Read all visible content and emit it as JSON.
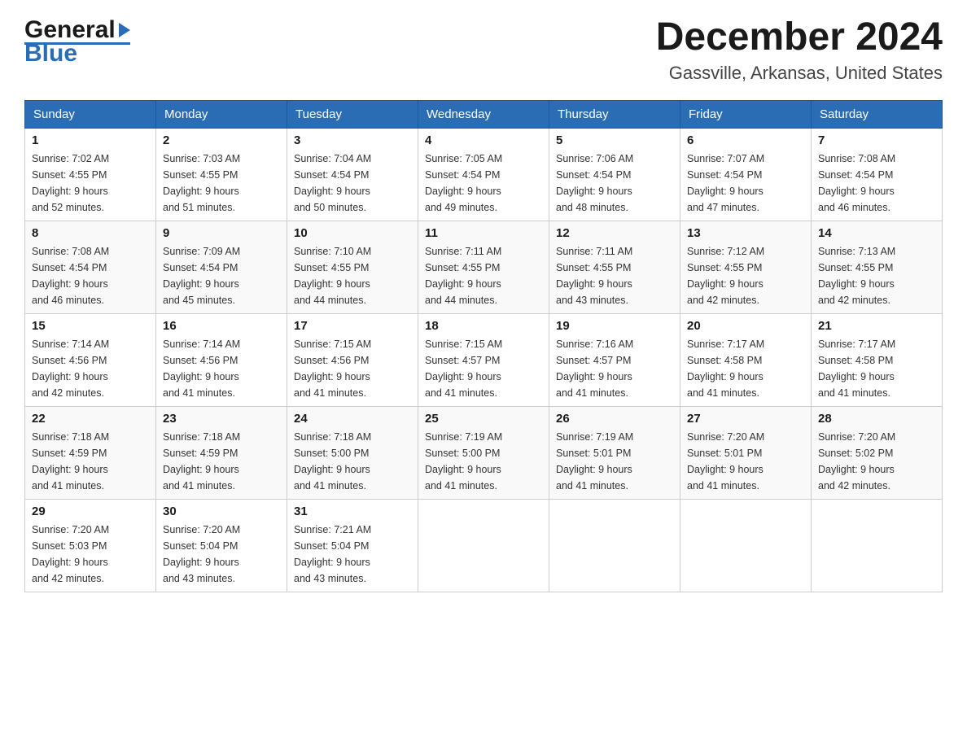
{
  "header": {
    "logo_text1": "General",
    "logo_text2": "Blue",
    "month_title": "December 2024",
    "location": "Gassville, Arkansas, United States"
  },
  "days_of_week": [
    "Sunday",
    "Monday",
    "Tuesday",
    "Wednesday",
    "Thursday",
    "Friday",
    "Saturday"
  ],
  "weeks": [
    [
      {
        "day": "1",
        "sunrise": "7:02 AM",
        "sunset": "4:55 PM",
        "daylight": "9 hours and 52 minutes."
      },
      {
        "day": "2",
        "sunrise": "7:03 AM",
        "sunset": "4:55 PM",
        "daylight": "9 hours and 51 minutes."
      },
      {
        "day": "3",
        "sunrise": "7:04 AM",
        "sunset": "4:54 PM",
        "daylight": "9 hours and 50 minutes."
      },
      {
        "day": "4",
        "sunrise": "7:05 AM",
        "sunset": "4:54 PM",
        "daylight": "9 hours and 49 minutes."
      },
      {
        "day": "5",
        "sunrise": "7:06 AM",
        "sunset": "4:54 PM",
        "daylight": "9 hours and 48 minutes."
      },
      {
        "day": "6",
        "sunrise": "7:07 AM",
        "sunset": "4:54 PM",
        "daylight": "9 hours and 47 minutes."
      },
      {
        "day": "7",
        "sunrise": "7:08 AM",
        "sunset": "4:54 PM",
        "daylight": "9 hours and 46 minutes."
      }
    ],
    [
      {
        "day": "8",
        "sunrise": "7:08 AM",
        "sunset": "4:54 PM",
        "daylight": "9 hours and 46 minutes."
      },
      {
        "day": "9",
        "sunrise": "7:09 AM",
        "sunset": "4:54 PM",
        "daylight": "9 hours and 45 minutes."
      },
      {
        "day": "10",
        "sunrise": "7:10 AM",
        "sunset": "4:55 PM",
        "daylight": "9 hours and 44 minutes."
      },
      {
        "day": "11",
        "sunrise": "7:11 AM",
        "sunset": "4:55 PM",
        "daylight": "9 hours and 44 minutes."
      },
      {
        "day": "12",
        "sunrise": "7:11 AM",
        "sunset": "4:55 PM",
        "daylight": "9 hours and 43 minutes."
      },
      {
        "day": "13",
        "sunrise": "7:12 AM",
        "sunset": "4:55 PM",
        "daylight": "9 hours and 42 minutes."
      },
      {
        "day": "14",
        "sunrise": "7:13 AM",
        "sunset": "4:55 PM",
        "daylight": "9 hours and 42 minutes."
      }
    ],
    [
      {
        "day": "15",
        "sunrise": "7:14 AM",
        "sunset": "4:56 PM",
        "daylight": "9 hours and 42 minutes."
      },
      {
        "day": "16",
        "sunrise": "7:14 AM",
        "sunset": "4:56 PM",
        "daylight": "9 hours and 41 minutes."
      },
      {
        "day": "17",
        "sunrise": "7:15 AM",
        "sunset": "4:56 PM",
        "daylight": "9 hours and 41 minutes."
      },
      {
        "day": "18",
        "sunrise": "7:15 AM",
        "sunset": "4:57 PM",
        "daylight": "9 hours and 41 minutes."
      },
      {
        "day": "19",
        "sunrise": "7:16 AM",
        "sunset": "4:57 PM",
        "daylight": "9 hours and 41 minutes."
      },
      {
        "day": "20",
        "sunrise": "7:17 AM",
        "sunset": "4:58 PM",
        "daylight": "9 hours and 41 minutes."
      },
      {
        "day": "21",
        "sunrise": "7:17 AM",
        "sunset": "4:58 PM",
        "daylight": "9 hours and 41 minutes."
      }
    ],
    [
      {
        "day": "22",
        "sunrise": "7:18 AM",
        "sunset": "4:59 PM",
        "daylight": "9 hours and 41 minutes."
      },
      {
        "day": "23",
        "sunrise": "7:18 AM",
        "sunset": "4:59 PM",
        "daylight": "9 hours and 41 minutes."
      },
      {
        "day": "24",
        "sunrise": "7:18 AM",
        "sunset": "5:00 PM",
        "daylight": "9 hours and 41 minutes."
      },
      {
        "day": "25",
        "sunrise": "7:19 AM",
        "sunset": "5:00 PM",
        "daylight": "9 hours and 41 minutes."
      },
      {
        "day": "26",
        "sunrise": "7:19 AM",
        "sunset": "5:01 PM",
        "daylight": "9 hours and 41 minutes."
      },
      {
        "day": "27",
        "sunrise": "7:20 AM",
        "sunset": "5:01 PM",
        "daylight": "9 hours and 41 minutes."
      },
      {
        "day": "28",
        "sunrise": "7:20 AM",
        "sunset": "5:02 PM",
        "daylight": "9 hours and 42 minutes."
      }
    ],
    [
      {
        "day": "29",
        "sunrise": "7:20 AM",
        "sunset": "5:03 PM",
        "daylight": "9 hours and 42 minutes."
      },
      {
        "day": "30",
        "sunrise": "7:20 AM",
        "sunset": "5:04 PM",
        "daylight": "9 hours and 43 minutes."
      },
      {
        "day": "31",
        "sunrise": "7:21 AM",
        "sunset": "5:04 PM",
        "daylight": "9 hours and 43 minutes."
      },
      null,
      null,
      null,
      null
    ]
  ],
  "labels": {
    "sunrise": "Sunrise:",
    "sunset": "Sunset:",
    "daylight": "Daylight:"
  }
}
